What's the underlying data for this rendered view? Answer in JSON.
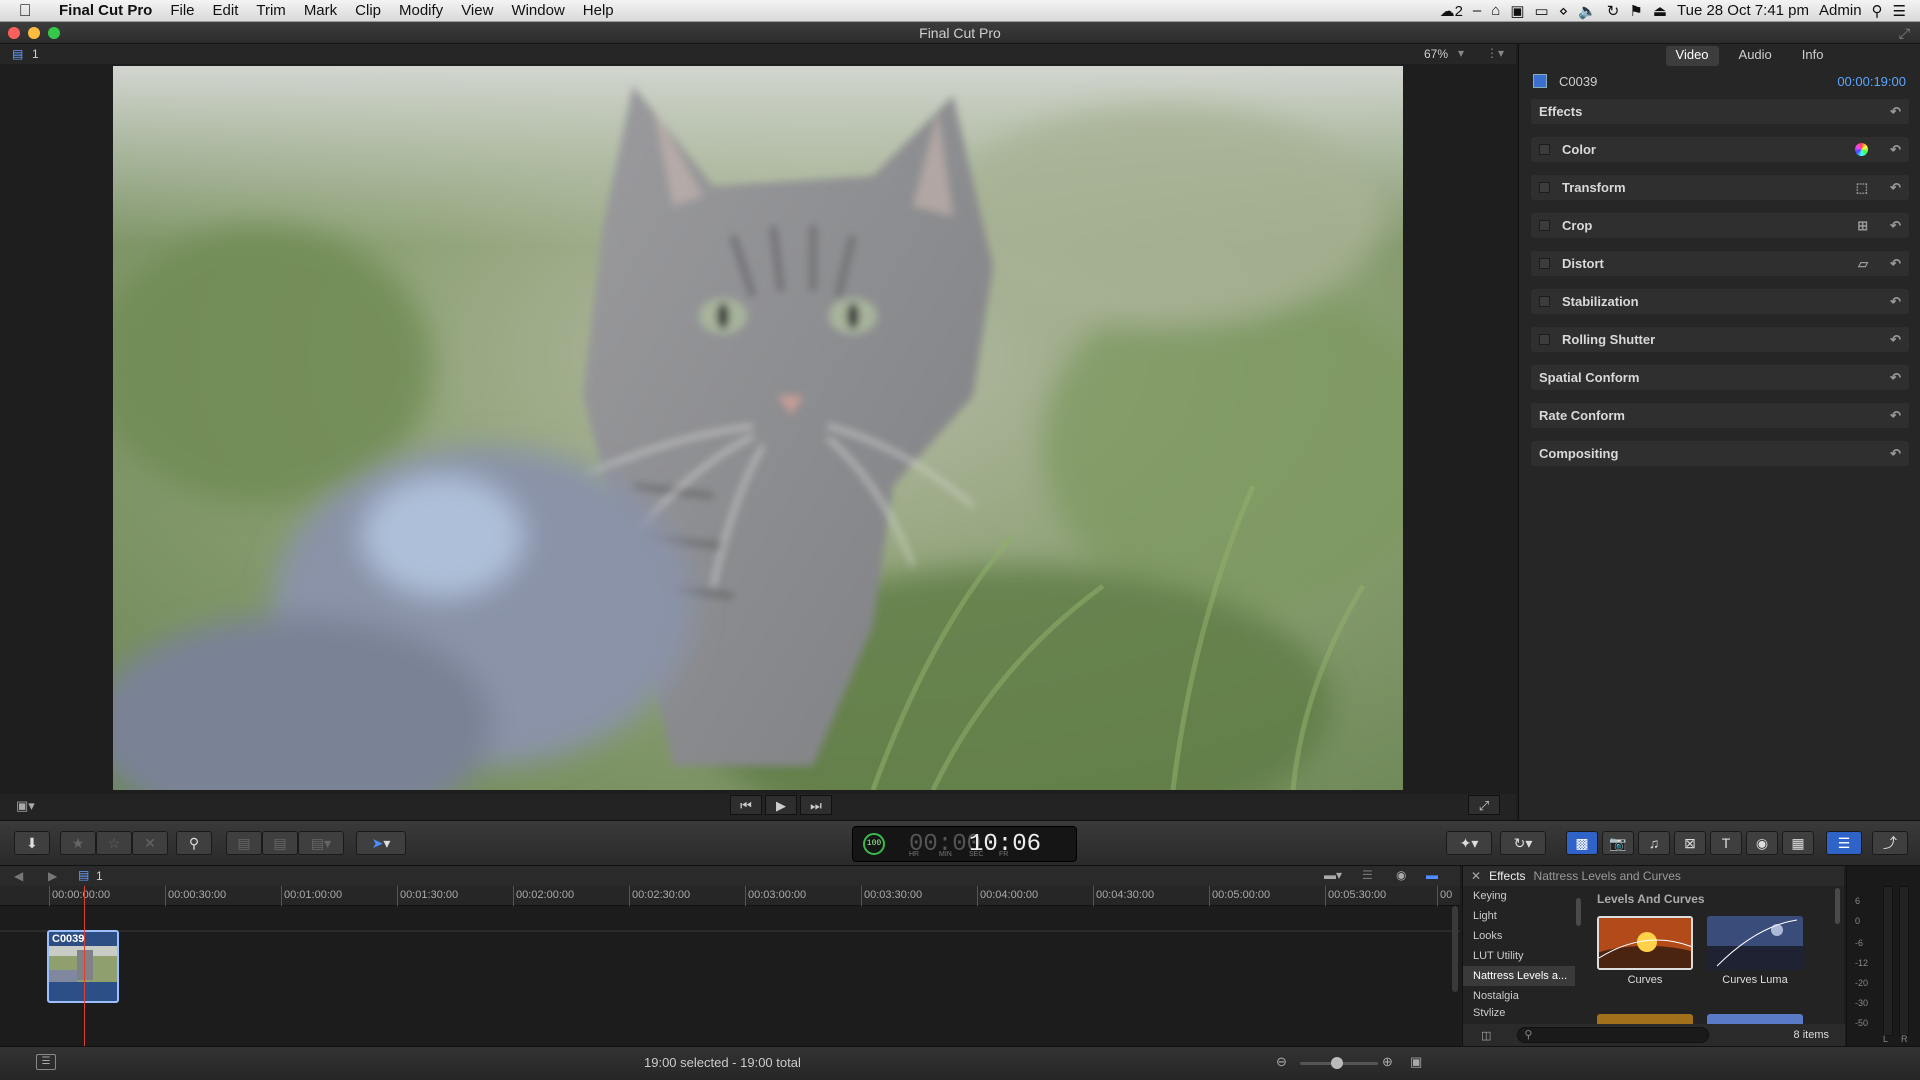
{
  "menubar": {
    "app": "Final Cut Pro",
    "items": [
      "File",
      "Edit",
      "Trim",
      "Mark",
      "Clip",
      "Modify",
      "View",
      "Window",
      "Help"
    ],
    "cc_count": "2",
    "clock": "Tue 28 Oct  7:41 pm",
    "user": "Admin"
  },
  "window": {
    "title": "Final Cut Pro"
  },
  "viewer": {
    "layer": "1",
    "zoom": "67%"
  },
  "inspector": {
    "tabs": [
      "Video",
      "Audio",
      "Info"
    ],
    "active_tab": "Video",
    "clip_name": "C0039",
    "timecode": "00:00:19:00",
    "sections": [
      {
        "label": "Effects",
        "checkbox": false,
        "icon": ""
      },
      {
        "label": "Color",
        "checkbox": true,
        "icon": "color-board-icon"
      },
      {
        "label": "Transform",
        "checkbox": true,
        "icon": "transform-icon"
      },
      {
        "label": "Crop",
        "checkbox": true,
        "icon": "crop-icon"
      },
      {
        "label": "Distort",
        "checkbox": true,
        "icon": "distort-icon"
      },
      {
        "label": "Stabilization",
        "checkbox": true,
        "icon": ""
      },
      {
        "label": "Rolling Shutter",
        "checkbox": true,
        "icon": ""
      },
      {
        "label": "Spatial Conform",
        "checkbox": false,
        "icon": ""
      },
      {
        "label": "Rate Conform",
        "checkbox": false,
        "icon": ""
      },
      {
        "label": "Compositing",
        "checkbox": false,
        "icon": ""
      }
    ]
  },
  "toolbar": {
    "dashboard_percent": "100",
    "timecode_dim": "00:00:",
    "timecode_main": "10:06",
    "timecode_units": [
      "HR",
      "MIN",
      "SEC",
      "FR"
    ]
  },
  "timeline": {
    "project_index": "1",
    "ruler": [
      "00:00:00:00",
      "00:00:30:00",
      "00:01:00:00",
      "00:01:30:00",
      "00:02:00:00",
      "00:02:30:00",
      "00:03:00:00",
      "00:03:30:00",
      "00:04:00:00",
      "00:04:30:00",
      "00:05:00:00",
      "00:05:30:00",
      "00"
    ],
    "clip_name": "C0039"
  },
  "browser": {
    "title": "Effects",
    "category": "Nattress Levels and Curves",
    "categories": [
      "Keying",
      "Light",
      "Looks",
      "LUT Utility",
      "Nattress Levels a...",
      "Nostalgia",
      "Stylize"
    ],
    "selected_category": "Nattress Levels a...",
    "group": "Levels And Curves",
    "items": [
      "Curves",
      "Curves Luma"
    ],
    "count": "8 items"
  },
  "meters": {
    "scale": [
      "6",
      "0",
      "-6",
      "-12",
      "-20",
      "-30",
      "-50"
    ],
    "channels": [
      "L",
      "R"
    ]
  },
  "status": {
    "selection": "19:00 selected - 19:00 total"
  },
  "colors": {
    "accent_blue": "#2f63c8",
    "timecode_blue": "#5aa6ff",
    "playhead": "#e04030"
  }
}
